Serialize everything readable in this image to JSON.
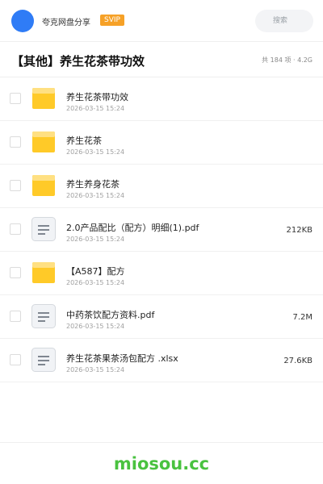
{
  "header": {
    "share_name": "夸克网盘分享",
    "badge": "SVIP",
    "search_placeholder": "搜索",
    "accent_color": "#2f7cf6",
    "badge_color": "#f6a127"
  },
  "folder": {
    "title": "【其他】养生花茶带功效",
    "summary": "共 184 项 · 4.2G"
  },
  "files": [
    {
      "name": "养生花茶带功效",
      "date": "2026-03-15 15:24",
      "size": "",
      "type": "folder-icon"
    },
    {
      "name": "养生花茶",
      "date": "2026-03-15 15:24",
      "size": "",
      "type": "folder-icon"
    },
    {
      "name": "养生养身花茶",
      "date": "2026-03-15 15:24",
      "size": "",
      "type": "folder-icon"
    },
    {
      "name": "2.0产品配比（配方）明细(1).pdf",
      "date": "2026-03-15 15:24",
      "size": "212KB",
      "type": "document-icon"
    },
    {
      "name": "【A587】配方",
      "date": "2026-03-15 15:24",
      "size": "",
      "type": "folder-icon"
    },
    {
      "name": "中药茶饮配方资料.pdf",
      "date": "2026-03-15 15:24",
      "size": "7.2M",
      "type": "document-icon"
    },
    {
      "name": "养生花茶果茶汤包配方 .xlsx",
      "date": "2026-03-15 15:24",
      "size": "27.6KB",
      "type": "document-icon"
    }
  ],
  "footer": {
    "brand": "miosou.cc",
    "brand_color": "#49c23f"
  }
}
